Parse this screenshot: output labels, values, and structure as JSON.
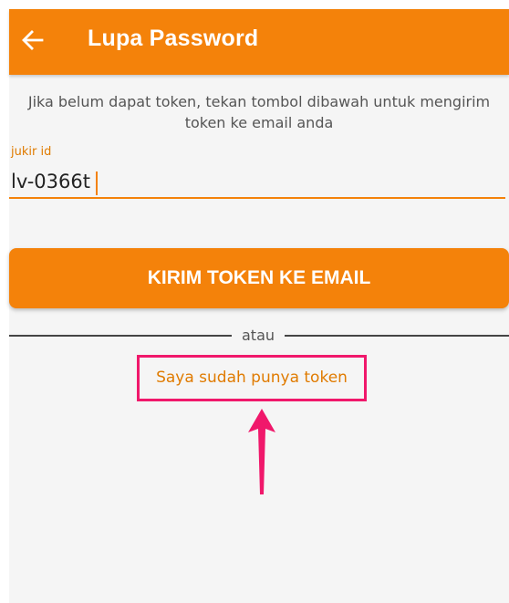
{
  "appbar": {
    "title": "Lupa Password",
    "back_icon": "arrow-left-icon",
    "background_color": "#f4820a"
  },
  "instruction": {
    "text": "Jika belum dapat token, tekan tombol dibawah untuk mengirim token ke email anda"
  },
  "form": {
    "field_label": "jukir id",
    "field_value": "lv-0366t"
  },
  "send_button": {
    "label": "KIRIM TOKEN KE EMAIL"
  },
  "divider": {
    "text": "atau"
  },
  "token_link": {
    "label": "Saya sudah punya token",
    "highlight_color": "#f0186b"
  },
  "annotation": {
    "arrow_icon": "arrow-up-icon",
    "color": "#f0186b"
  }
}
